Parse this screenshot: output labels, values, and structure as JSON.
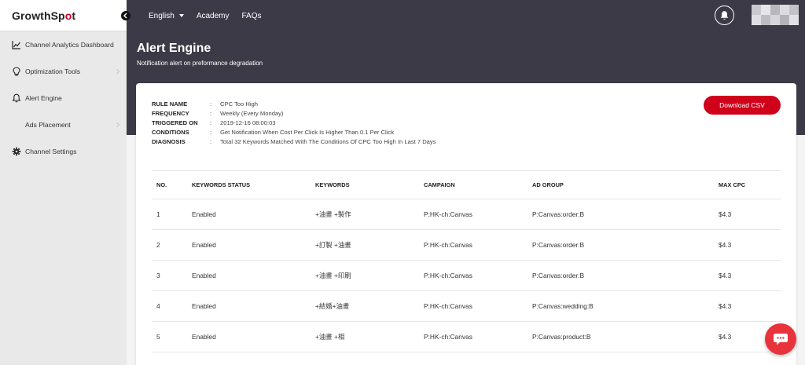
{
  "brand": {
    "name_prefix": "GrowthSp",
    "name_accent": "o",
    "name_suffix": "t"
  },
  "sidebar": {
    "items": [
      {
        "label": "Channel Analytics Dashboard",
        "icon": "chart-icon"
      },
      {
        "label": "Optimization Tools",
        "icon": "lightbulb-icon"
      },
      {
        "label": "Alert Engine",
        "icon": "bell-icon"
      },
      {
        "label": "Ads Placement",
        "icon": ""
      },
      {
        "label": "Channel Settings",
        "icon": "gear-icon"
      }
    ]
  },
  "topnav": {
    "language": "English",
    "academy": "Academy",
    "faqs": "FAQs"
  },
  "header": {
    "title": "Alert Engine",
    "subtitle": "Notification alert on preformance degradation"
  },
  "rule": {
    "name_label": "RULE NAME",
    "name_value": "CPC Too High",
    "frequency_label": "FREQUENCY",
    "frequency_value": "Weekly (Every Monday)",
    "triggered_label": "TRIGGERED ON",
    "triggered_value": "2019-12-16 08:00:03",
    "conditions_label": "CONDITIONS",
    "conditions_value": "Get Notification When Cost Per Click Is Higher Than 0.1 Per Click",
    "diagnosis_label": "DIAGNOSIS",
    "diagnosis_value": "Total 32 Keywords Matched With The Conditions Of CPC Too High In Last 7 Days",
    "colon": ":"
  },
  "download_label": "Download CSV",
  "table": {
    "headers": {
      "no": "NO.",
      "status": "KEYWORDS STATUS",
      "keywords": "KEYWORDS",
      "campaign": "CAMPAIGN",
      "ad_group": "AD GROUP",
      "max_cpc": "MAX CPC"
    },
    "rows": [
      {
        "no": "1",
        "status": "Enabled",
        "keywords": "+油畫 +製作",
        "campaign": "P:HK-ch:Canvas",
        "ad_group": "P:Canvas:order:B",
        "max_cpc": "$4.3"
      },
      {
        "no": "2",
        "status": "Enabled",
        "keywords": "+訂製 +油畫",
        "campaign": "P:HK-ch:Canvas",
        "ad_group": "P:Canvas:order:B",
        "max_cpc": "$4.3"
      },
      {
        "no": "3",
        "status": "Enabled",
        "keywords": "+油畫 +印刷",
        "campaign": "P:HK-ch:Canvas",
        "ad_group": "P:Canvas:order:B",
        "max_cpc": "$4.3"
      },
      {
        "no": "4",
        "status": "Enabled",
        "keywords": "+結婚+油畫",
        "campaign": "P:HK-ch:Canvas",
        "ad_group": "P:Canvas:wedding:B",
        "max_cpc": "$4.3"
      },
      {
        "no": "5",
        "status": "Enabled",
        "keywords": "+油畫 +相",
        "campaign": "P:HK-ch:Canvas",
        "ad_group": "P:Canvas:product:B",
        "max_cpc": "$4.3"
      }
    ]
  },
  "colors": {
    "accent": "#d0021b",
    "topbar": "#3d3a47",
    "sidebar": "#e9e9e9",
    "chat": "#e8323c"
  }
}
